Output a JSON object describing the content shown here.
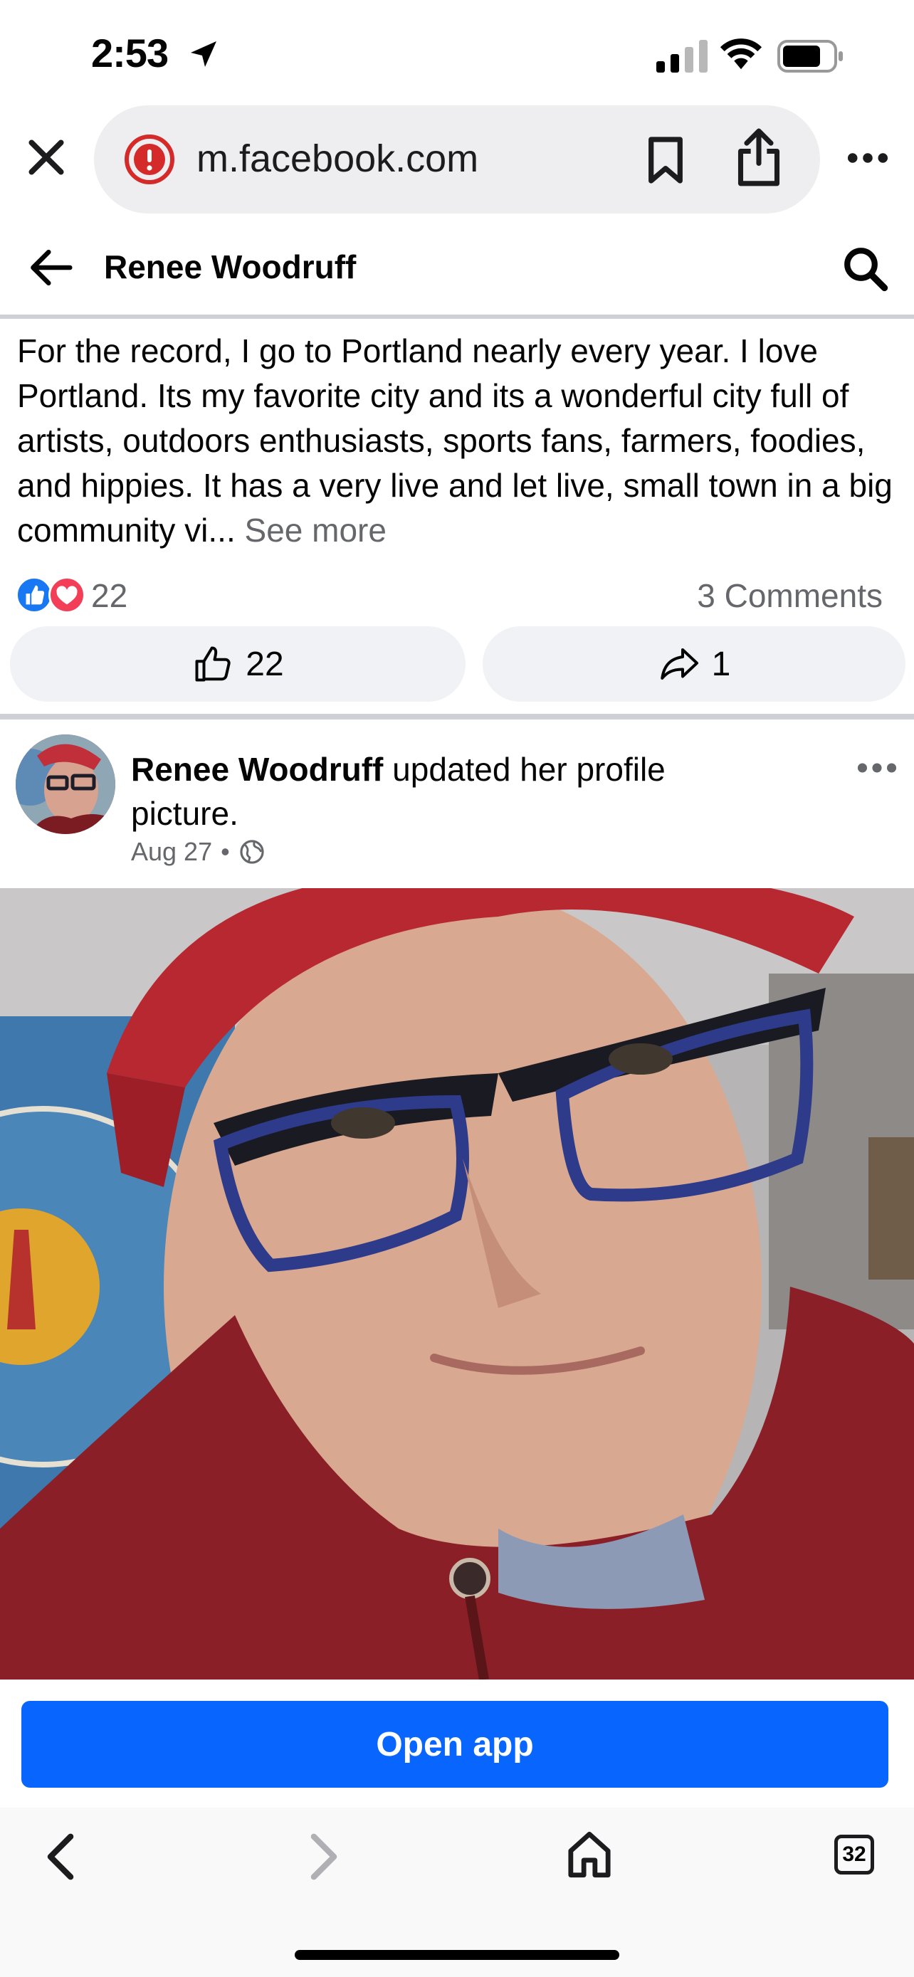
{
  "status_bar": {
    "time": "2:53"
  },
  "browser": {
    "url": "m.facebook.com",
    "tab_count": "32"
  },
  "header": {
    "title": "Renee Woodruff"
  },
  "post1": {
    "text": "For the record, I go to Portland nearly every year. I love Portland. Its my favorite city and its a wonderful city full of artists, outdoors enthusiasts, sports fans, farmers, foodies, and hippies. It has a very live and let live, small town in a big community vi...",
    "see_more": "See more",
    "reaction_count": "22",
    "comments": "3 Comments",
    "like_count": "22",
    "share_count": "1"
  },
  "post2": {
    "author": "Renee Woodruff",
    "action": " updated her profile picture.",
    "date": "Aug 27",
    "separator": "•"
  },
  "cta": {
    "open_app": "Open app"
  },
  "colors": {
    "brand_blue": "#0866ff",
    "like_blue": "#1877f2",
    "love_red": "#f33e58",
    "secondary_text": "#65676b"
  }
}
